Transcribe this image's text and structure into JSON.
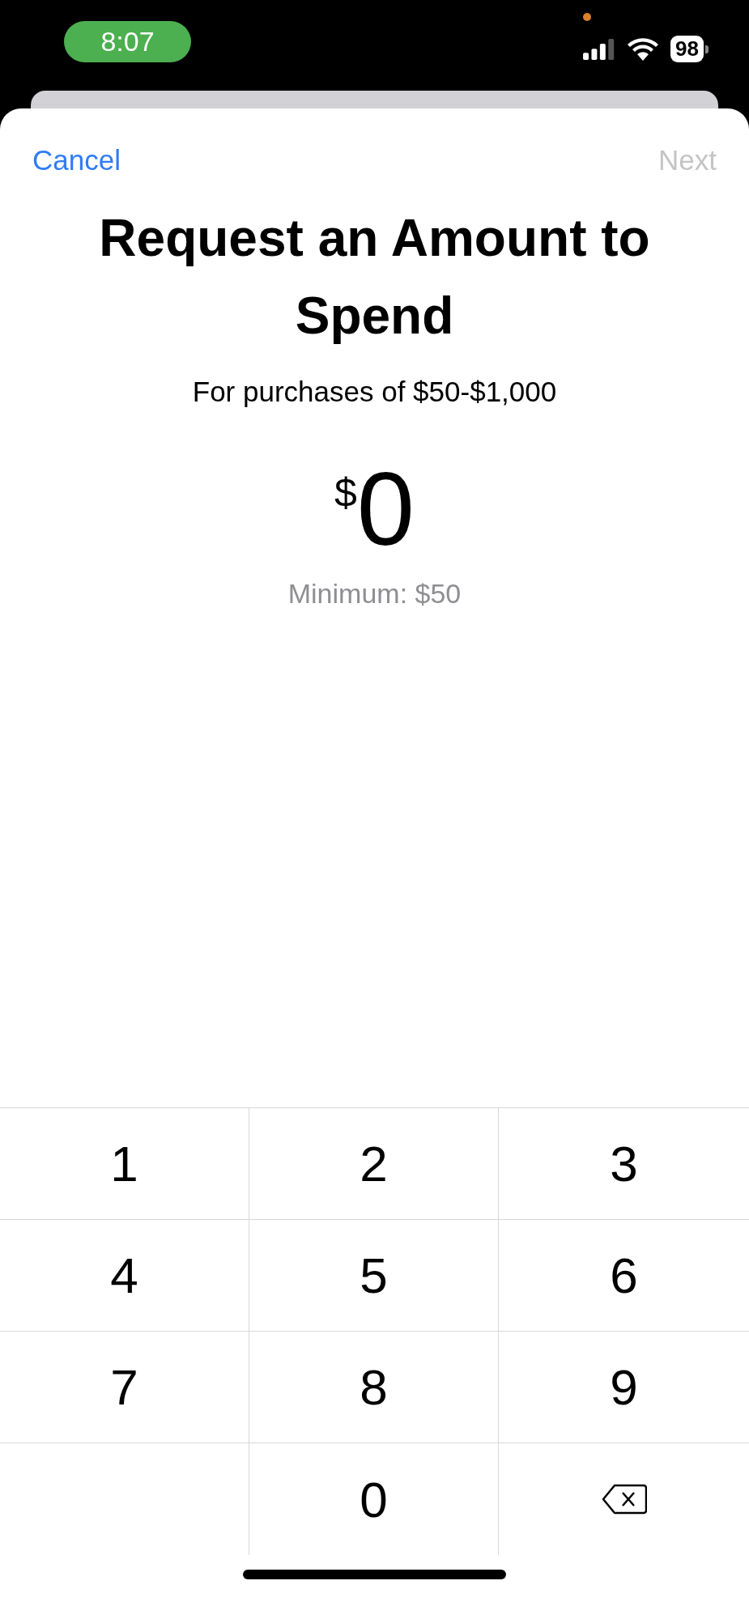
{
  "status_bar": {
    "time": "8:07",
    "battery": "98"
  },
  "nav": {
    "cancel": "Cancel",
    "next": {
      "label": "Next",
      "disabled": true
    }
  },
  "title": "Request an Amount to Spend",
  "subtitle": "For purchases of $50-$1,000",
  "amount": {
    "currency": "$",
    "value": "0"
  },
  "hint": "Minimum: $50",
  "keypad": [
    {
      "kind": "digit",
      "label": "1"
    },
    {
      "kind": "digit",
      "label": "2"
    },
    {
      "kind": "digit",
      "label": "3"
    },
    {
      "kind": "digit",
      "label": "4"
    },
    {
      "kind": "digit",
      "label": "5"
    },
    {
      "kind": "digit",
      "label": "6"
    },
    {
      "kind": "digit",
      "label": "7"
    },
    {
      "kind": "digit",
      "label": "8"
    },
    {
      "kind": "digit",
      "label": "9"
    },
    {
      "kind": "blank"
    },
    {
      "kind": "digit",
      "label": "0"
    },
    {
      "kind": "delete"
    }
  ]
}
